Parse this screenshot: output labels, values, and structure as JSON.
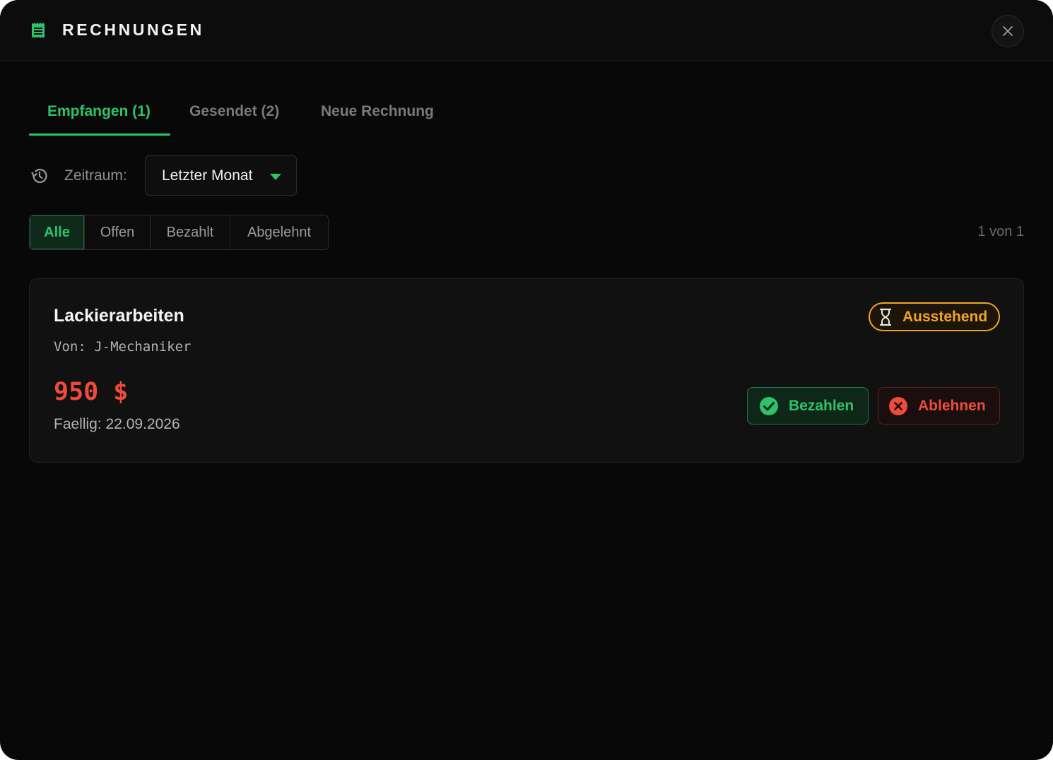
{
  "header": {
    "title": "RECHNUNGEN",
    "icon": "receipt-icon",
    "close_icon": "close-icon"
  },
  "tabs": [
    {
      "label": "Empfangen (1)",
      "active": true
    },
    {
      "label": "Gesendet (2)",
      "active": false
    },
    {
      "label": "Neue Rechnung",
      "active": false
    }
  ],
  "period": {
    "icon": "history-icon",
    "label": "Zeitraum:",
    "selected": "Letzter Monat"
  },
  "filters": {
    "items": [
      {
        "label": "Alle",
        "active": true
      },
      {
        "label": "Offen",
        "active": false
      },
      {
        "label": "Bezahlt",
        "active": false
      },
      {
        "label": "Abgelehnt",
        "active": false
      }
    ],
    "page_count": "1 von 1"
  },
  "invoice": {
    "title": "Lackierarbeiten",
    "from": "Von: J-Mechaniker",
    "amount": "950 $",
    "due": "Faellig: 22.09.2026",
    "status": "Ausstehend",
    "status_icon": "hourglass-icon",
    "pay_label": "Bezahlen",
    "pay_icon": "check-circle-icon",
    "decline_label": "Ablehnen",
    "decline_icon": "x-circle-icon"
  },
  "colors": {
    "accent": "#2ec26a",
    "danger": "#ef4a3c",
    "warning": "#f0a427",
    "background": "#080808"
  }
}
